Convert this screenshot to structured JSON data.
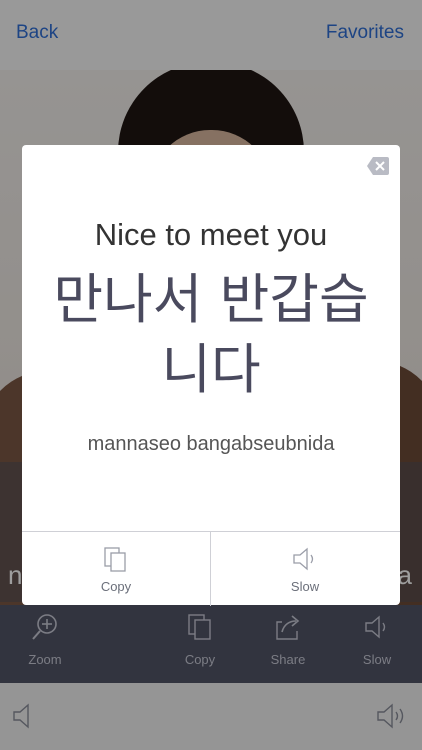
{
  "nav": {
    "back_label": "Back",
    "favorites_label": "Favorites"
  },
  "background_banner": {
    "left_fragment": "n",
    "right_fragment": "a"
  },
  "toolbar": {
    "zoom_label": "Zoom",
    "copy_label": "Copy",
    "share_label": "Share",
    "slow_label": "Slow"
  },
  "card": {
    "english": "Nice to meet you",
    "korean": "만나서 반갑습니다",
    "romanization": "mannaseo bangabseubnida",
    "copy_label": "Copy",
    "slow_label": "Slow"
  },
  "colors": {
    "link": "#2f6fd6",
    "toolbar_bg": "#525566",
    "korean_text": "#4a4a5e"
  }
}
